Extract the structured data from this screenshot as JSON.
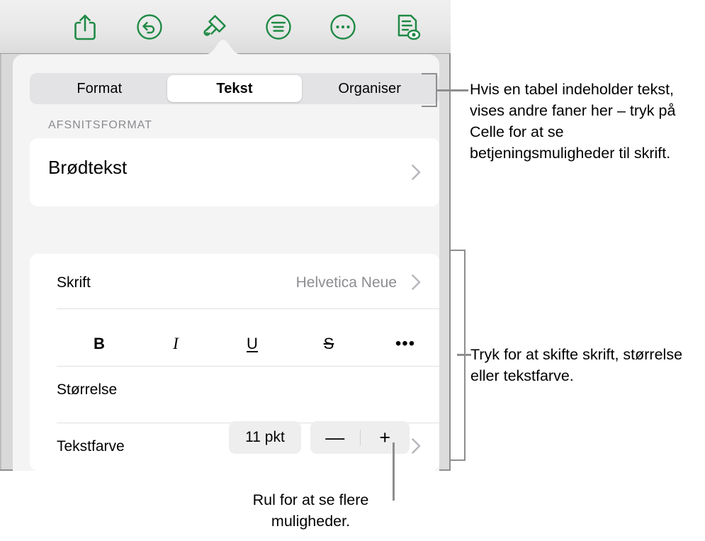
{
  "toolbar": {
    "buttons": [
      {
        "name": "share-icon",
        "label": "Del"
      },
      {
        "name": "undo-icon",
        "label": "Fortryd"
      },
      {
        "name": "paintbrush-icon",
        "label": "Format",
        "selected": true
      },
      {
        "name": "insert-icon",
        "label": "Indsæt"
      },
      {
        "name": "more-icon",
        "label": "Mere"
      },
      {
        "name": "document-preview-icon",
        "label": "Dokument"
      }
    ],
    "accent_color": "#1f8a45"
  },
  "panel": {
    "tabs": [
      {
        "label": "Format",
        "selected": false
      },
      {
        "label": "Tekst",
        "selected": true
      },
      {
        "label": "Organiser",
        "selected": false
      }
    ],
    "paragraph_section": {
      "header": "AFSNITSFORMAT",
      "style_name": "Brødtekst"
    },
    "font_section": {
      "font_label": "Skrift",
      "font_value": "Helvetica Neue",
      "format_buttons": [
        {
          "name": "bold-button",
          "glyph": "B"
        },
        {
          "name": "italic-button",
          "glyph": "I"
        },
        {
          "name": "underline-button",
          "glyph": "U"
        },
        {
          "name": "strikethrough-button",
          "glyph": "S"
        },
        {
          "name": "more-text-options-button",
          "glyph": "•••"
        }
      ],
      "size_label": "Størrelse",
      "size_value": "11 pkt",
      "decrement": "—",
      "increment": "+",
      "color_label": "Tekstfarve",
      "color_value": "#000000"
    }
  },
  "callouts": {
    "tabs_note": "Hvis en tabel indeholder tekst, vises andre faner her – tryk på Celle for at se betjeningsmuligheder til skrift.",
    "font_note": "Tryk for at skifte skrift, størrelse eller tekstfarve.",
    "scroll_note": "Rul for at se flere muligheder."
  }
}
